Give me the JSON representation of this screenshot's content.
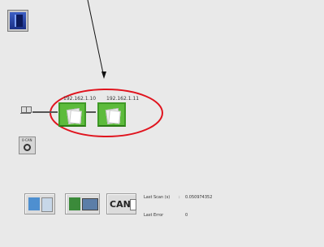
{
  "nodes": [
    {
      "ip": "192.162.1.10"
    },
    {
      "ip": "192.162.1.11"
    }
  ],
  "port_label": "0-CAN",
  "toolbar": {
    "can_label": "CAN"
  },
  "status": {
    "last_scan_label": "Last Scan (s)",
    "last_scan_sep": ":",
    "last_scan_value": "0.050974352",
    "last_error_label": "Last Error",
    "last_error_value": "0"
  },
  "colors": {
    "node_green": "#5dbb3c",
    "highlight_red": "#e0141e"
  }
}
